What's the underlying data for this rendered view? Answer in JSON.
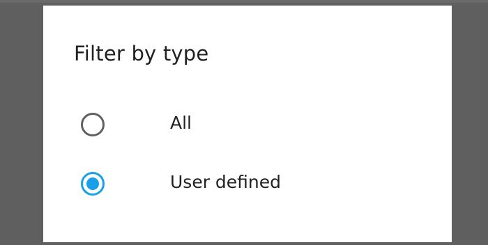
{
  "dialog": {
    "title": "Filter by type",
    "options": [
      {
        "label": "All",
        "selected": false
      },
      {
        "label": "User defined",
        "selected": true
      }
    ]
  },
  "colors": {
    "accent": "#1aa0e8",
    "scrim": "#5f5f5f",
    "text": "#212121",
    "radio_unchecked": "#616161"
  }
}
